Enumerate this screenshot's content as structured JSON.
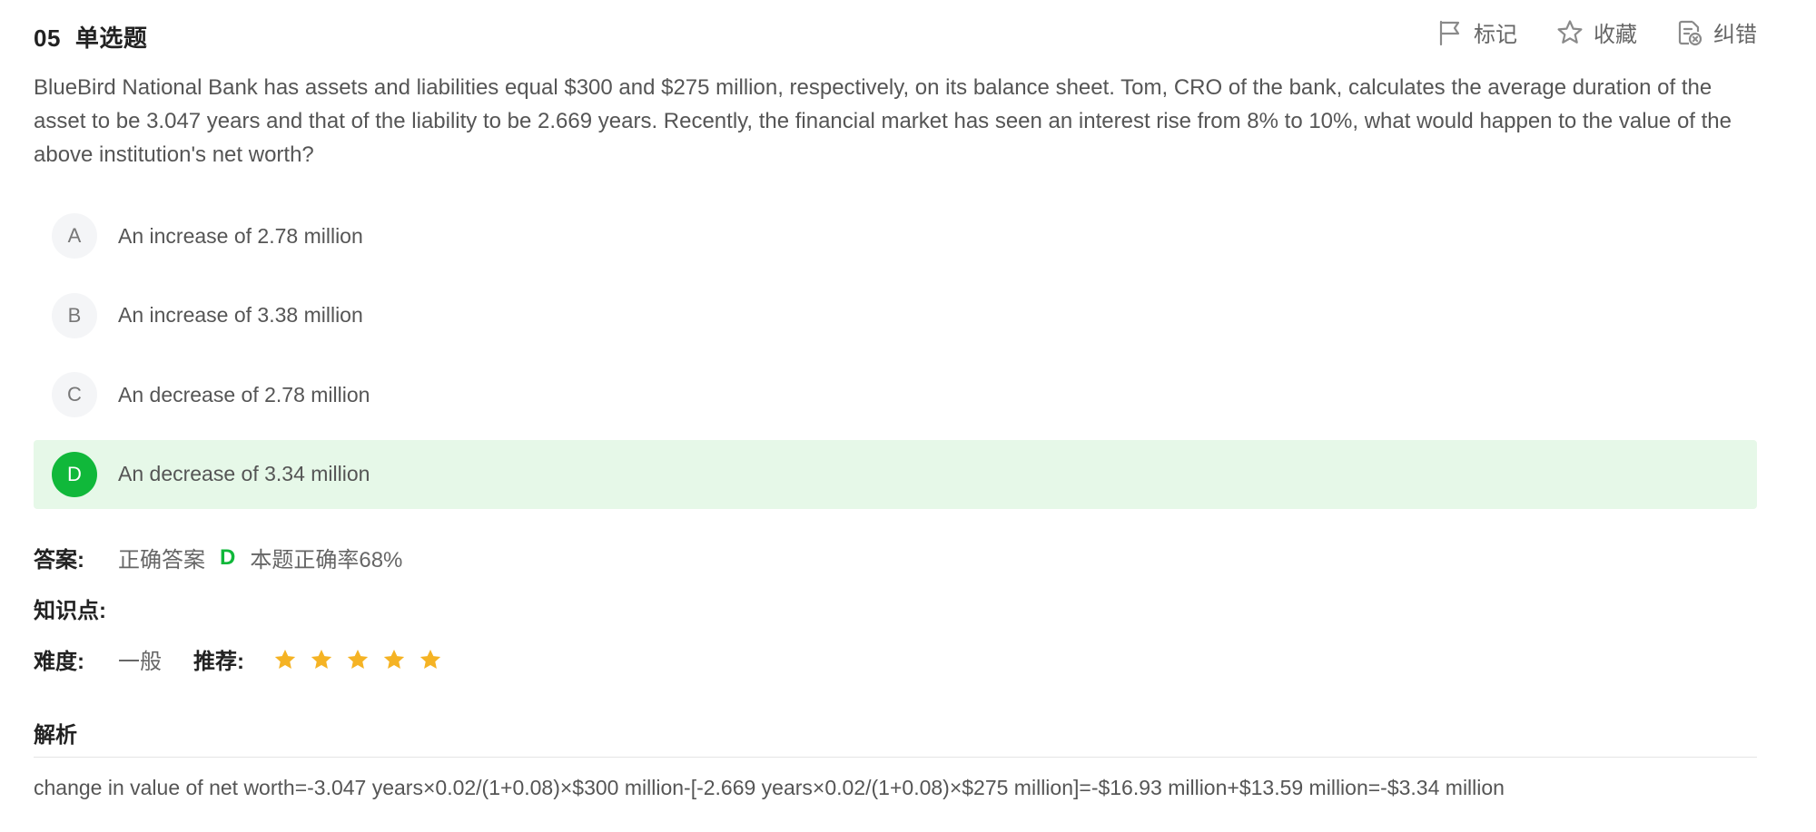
{
  "question": {
    "number": "05",
    "type_label": "单选题",
    "stem": "BlueBird National Bank has assets and liabilities equal $300 and $275 million, respectively, on its balance sheet. Tom, CRO of the bank, calculates the average duration of the asset to be 3.047 years and that of the liability to be 2.669 years. Recently, the financial market has seen an interest rise from 8% to 10%, what would happen to the value of the above institution's net worth?"
  },
  "toolbar": {
    "mark_label": "标记",
    "favorite_label": "收藏",
    "report_label": "纠错"
  },
  "options": [
    {
      "letter": "A",
      "text": "An increase of 2.78 million",
      "correct": false
    },
    {
      "letter": "B",
      "text": "An increase of 3.38 million",
      "correct": false
    },
    {
      "letter": "C",
      "text": "An decrease of 2.78 million",
      "correct": false
    },
    {
      "letter": "D",
      "text": "An decrease of 3.34 million",
      "correct": true
    }
  ],
  "answer": {
    "label": "答案:",
    "correct_prefix": "正确答案",
    "correct_letter": "D",
    "accuracy_text": "本题正确率68%"
  },
  "knowledge": {
    "label": "知识点:"
  },
  "difficulty": {
    "label": "难度:",
    "value": "一般",
    "recommend_label": "推荐:",
    "stars": 5,
    "star_color": "#f5b324"
  },
  "analysis": {
    "title": "解析",
    "text": "change in value of net worth=-3.047 years×0.02/(1+0.08)×$300 million-[-2.669 years×0.02/(1+0.08)×$275 million]=-$16.93 million+$13.59 million=-$3.34 million"
  },
  "colors": {
    "accent_green": "#10b83a",
    "correct_bg": "#e6f8e8"
  }
}
